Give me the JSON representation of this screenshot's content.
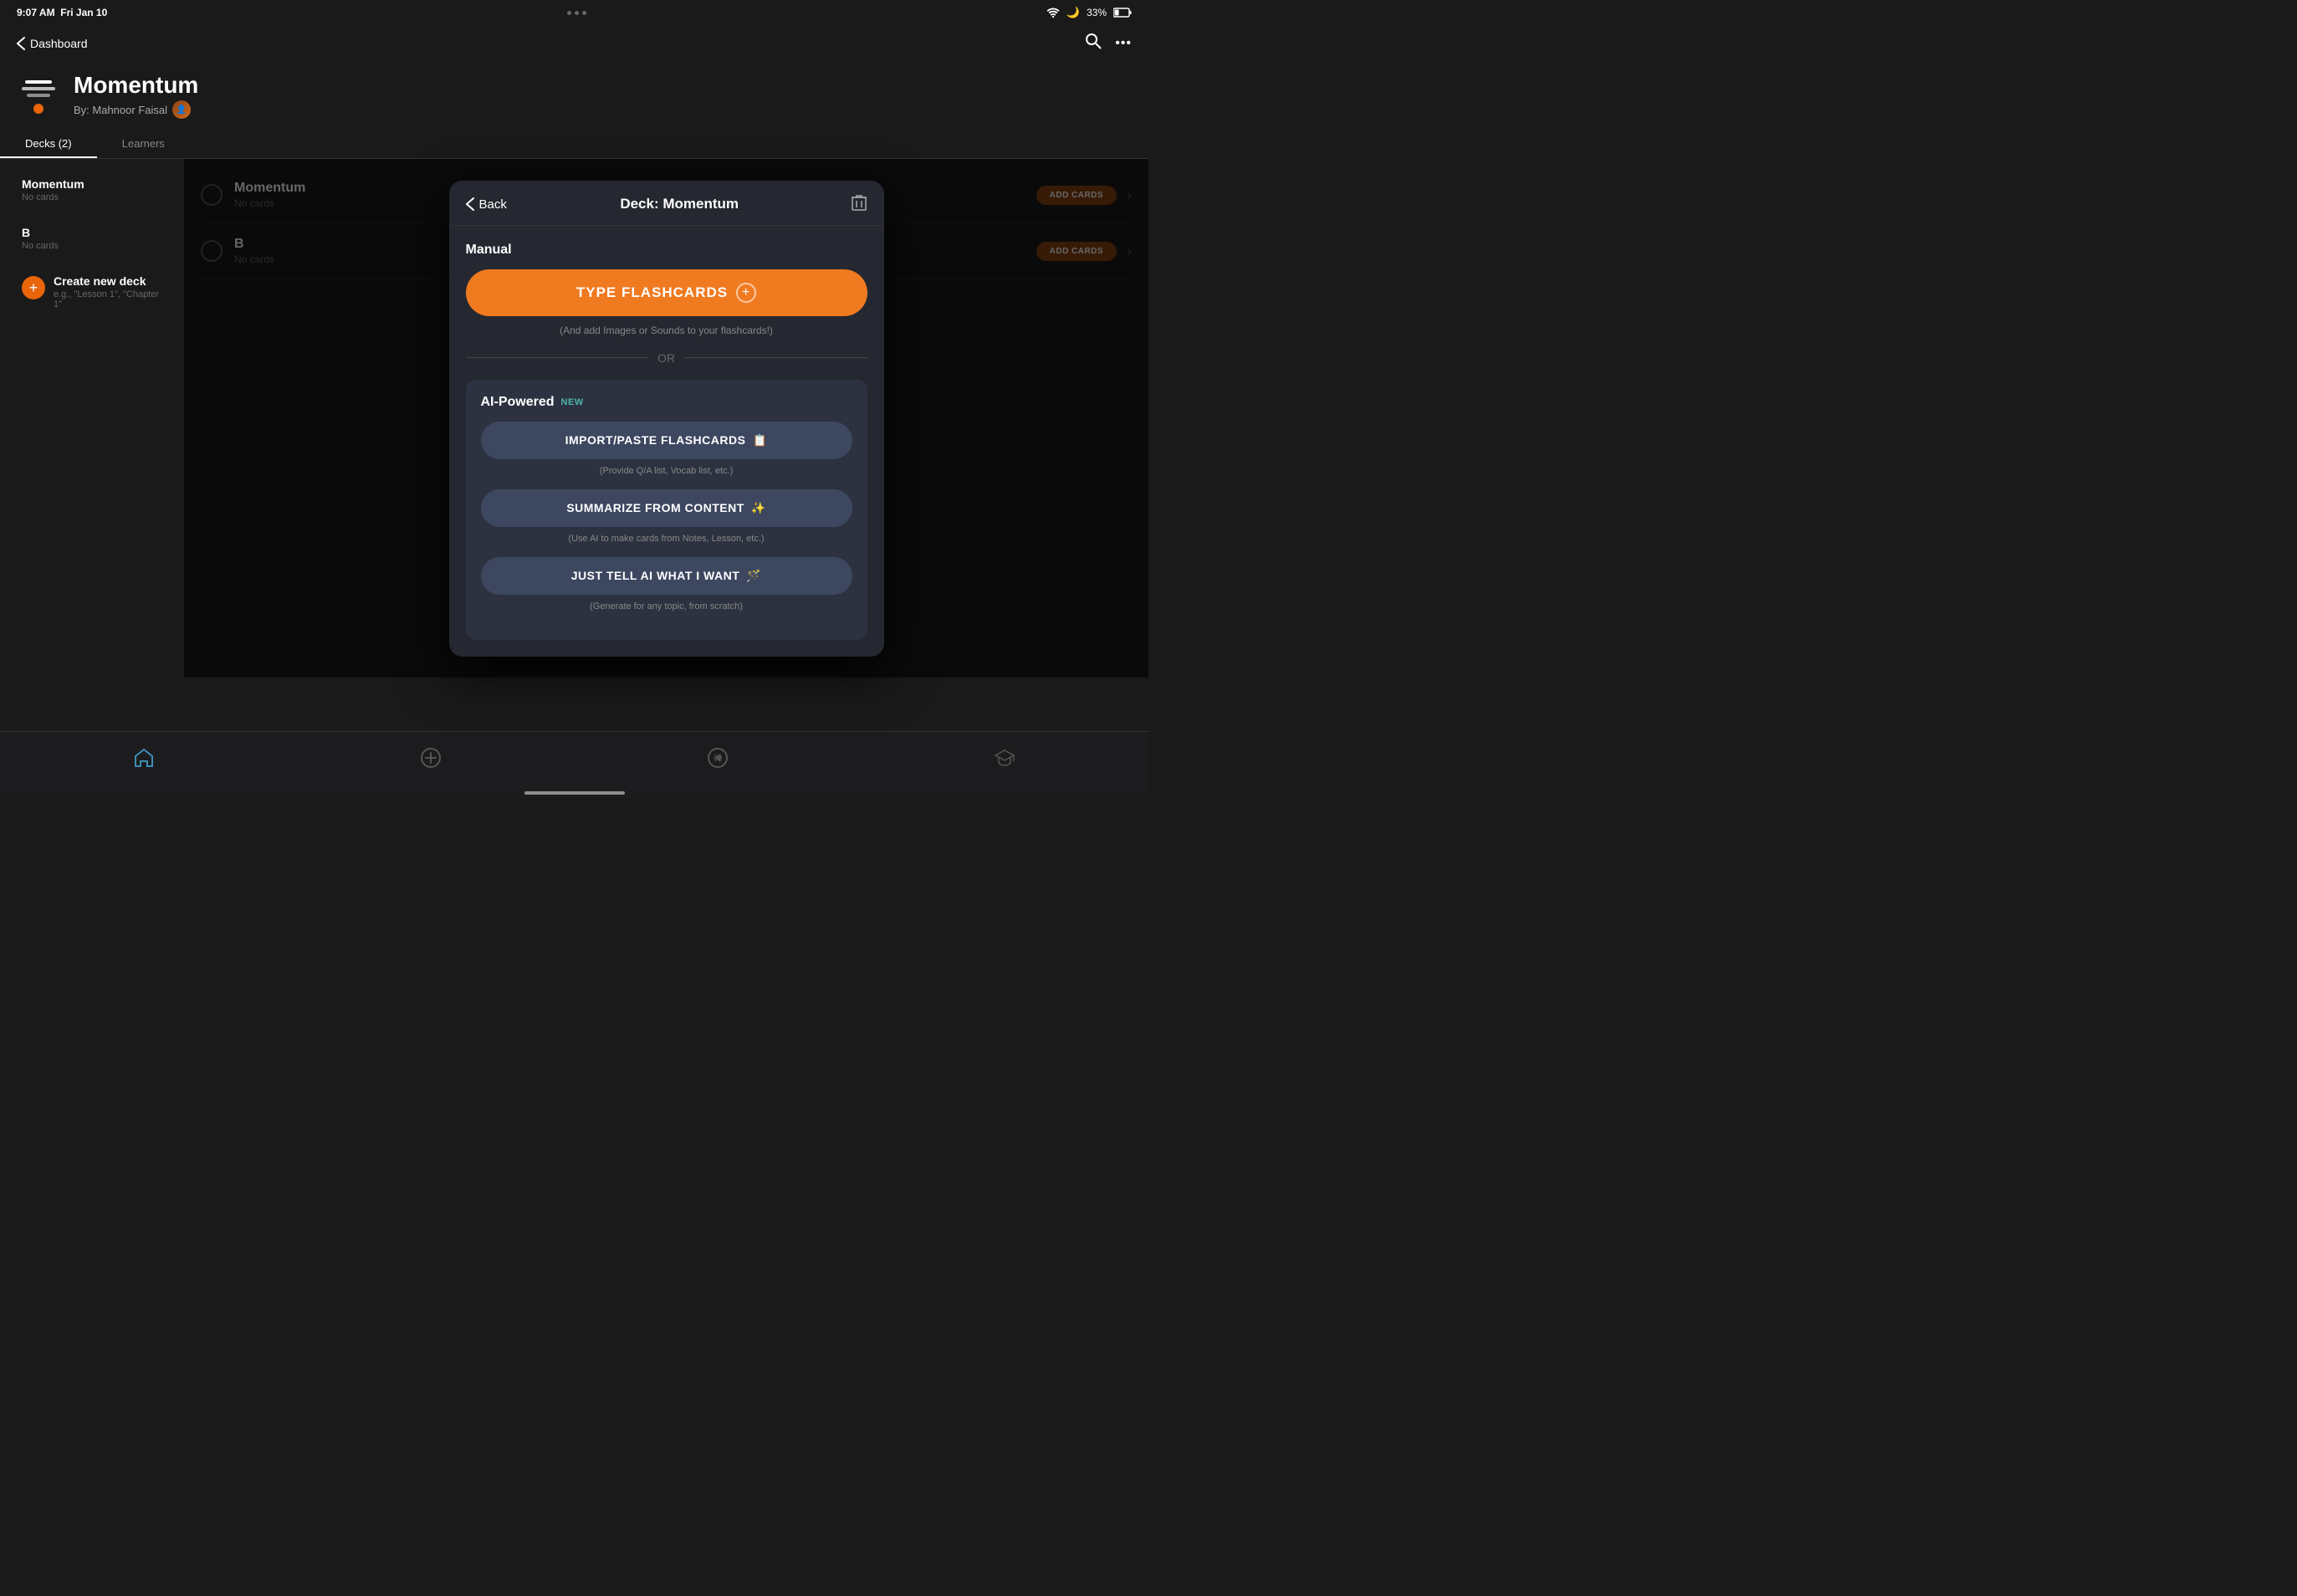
{
  "statusBar": {
    "time": "9:07 AM",
    "day": "Fri Jan 10",
    "battery": "33%"
  },
  "nav": {
    "backLabel": "Dashboard",
    "searchIcon": "🔍",
    "moreIcon": "•••"
  },
  "appHeader": {
    "title": "Momentum",
    "subtitle": "By: Mahnoor Faisal"
  },
  "tabs": {
    "items": [
      {
        "label": "Decks (2)",
        "active": true
      },
      {
        "label": "Learners",
        "active": false
      }
    ]
  },
  "sidebar": {
    "decks": [
      {
        "name": "Momentum",
        "cardCount": "No cards"
      },
      {
        "name": "B",
        "cardCount": "No cards"
      }
    ],
    "createDeck": {
      "label": "Create new deck",
      "hint": "e.g., \"Lesson 1\", \"Chapter 1\""
    }
  },
  "modal": {
    "backLabel": "Back",
    "title": "Deck: Momentum",
    "manual": {
      "sectionLabel": "Manual",
      "typeFlashcardsBtn": "TYPE FLASHCARDS",
      "hint": "(And add Images or Sounds to your flashcards!)"
    },
    "divider": "OR",
    "ai": {
      "sectionLabel": "AI-Powered",
      "newBadge": "NEW",
      "buttons": [
        {
          "label": "IMPORT/PASTE FLASHCARDS",
          "hint": "(Provide Q/A list, Vocab list, etc.)",
          "icon": "📋"
        },
        {
          "label": "SUMMARIZE FROM CONTENT",
          "hint": "(Use AI to make cards from Notes, Lesson, etc.)",
          "icon": "✨"
        },
        {
          "label": "JUST TELL AI WHAT I WANT",
          "hint": "(Generate for any topic, from scratch)",
          "icon": "🪄"
        }
      ]
    }
  },
  "rightPanel": {
    "decks": [
      {
        "name": "Momentum",
        "cardCount": "No cards",
        "addBtnLabel": "ADD CARDS"
      },
      {
        "name": "B",
        "cardCount": "No cards",
        "addBtnLabel": "ADD CARDS"
      }
    ]
  },
  "bottomTabs": [
    {
      "icon": "🏠",
      "active": true
    },
    {
      "icon": "➕",
      "active": false
    },
    {
      "icon": "🧭",
      "active": false
    },
    {
      "icon": "🎓",
      "active": false
    }
  ]
}
